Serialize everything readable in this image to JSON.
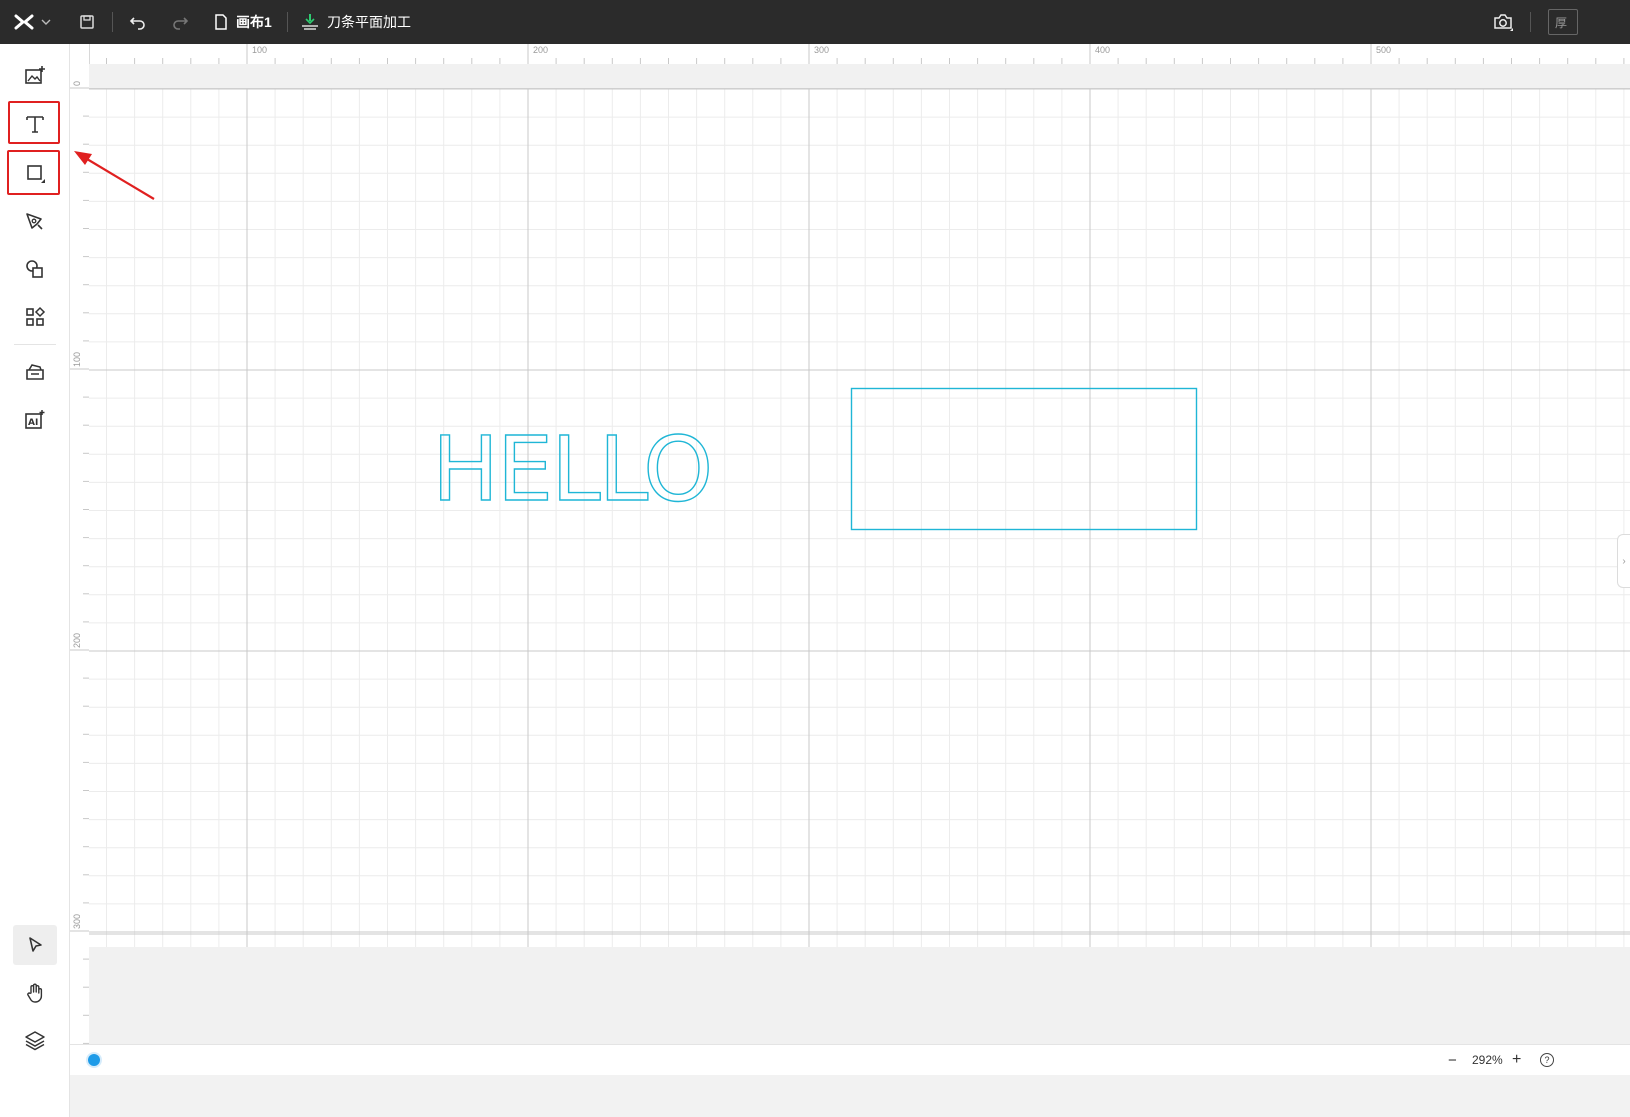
{
  "topbar": {
    "logo_icon": "x-logo-icon",
    "canvas_name": "画布1",
    "mode_label": "刀条平面加工",
    "right_cut_text": "厚"
  },
  "left_tools": [
    {
      "name": "image-add-tool",
      "icon": "image-plus-icon"
    },
    {
      "name": "text-tool",
      "icon": "text-t-icon",
      "highlighted": true
    },
    {
      "name": "rectangle-tool",
      "icon": "square-icon",
      "highlighted": true
    },
    {
      "name": "pen-tool",
      "icon": "pen-nib-icon"
    },
    {
      "name": "shapes-tool",
      "icon": "shapes-icon"
    },
    {
      "name": "elements-tool",
      "icon": "grid-elements-icon"
    },
    {
      "name": "material-library-tool",
      "icon": "library-icon"
    },
    {
      "name": "ai-tool",
      "icon": "ai-icon"
    }
  ],
  "bottom_tools": [
    {
      "name": "select-tool",
      "icon": "cursor-arrow-icon",
      "active": true
    },
    {
      "name": "hand-tool",
      "icon": "hand-icon"
    },
    {
      "name": "layers-tool",
      "icon": "layers-icon"
    }
  ],
  "ruler": {
    "top_labels": [
      "100",
      "200",
      "300",
      "400",
      "500"
    ],
    "left_labels": [
      "0",
      "100",
      "200",
      "300"
    ]
  },
  "canvas": {
    "text_object": "HELLO",
    "object_color": "#1fb6d6"
  },
  "status": {
    "zoom_value": "292%",
    "zoom_out": "−",
    "zoom_in": "+",
    "help": "?"
  },
  "annotation_color": "#e02020"
}
